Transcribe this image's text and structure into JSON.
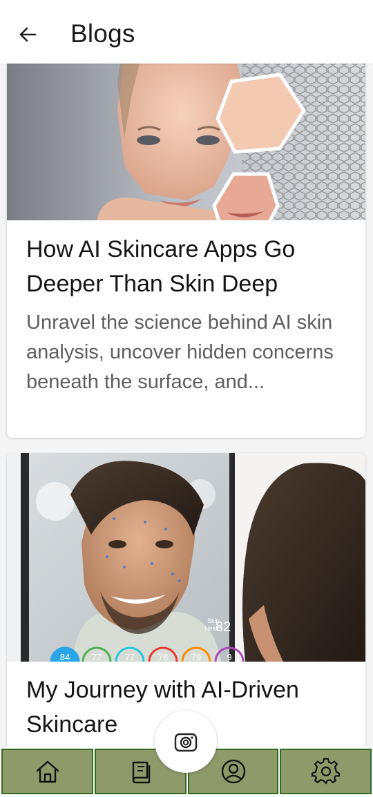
{
  "header": {
    "title": "Blogs",
    "back_icon": "arrow-left-icon"
  },
  "posts": [
    {
      "title": "How AI Skincare Apps Go Deeper Than Skin Deep",
      "excerpt": "Unravel the science behind AI skin analysis, uncover hidden concerns beneath the surface, and..."
    },
    {
      "title": "My Journey with AI-Driven Skincare",
      "overlay": {
        "label_line1": "Skin",
        "label_line2": "Health",
        "score": "82",
        "metric_values": [
          "84",
          "77",
          "77",
          "78",
          "79",
          "9"
        ]
      }
    }
  ],
  "nav": {
    "items": [
      "home-icon",
      "book-icon",
      "profile-icon",
      "settings-icon"
    ],
    "fab_icon": "camera-icon"
  },
  "colors": {
    "nav_bg": "#8f9a6b",
    "nav_border": "#2f6a1e",
    "accent_blue": "#2aa6e8"
  }
}
